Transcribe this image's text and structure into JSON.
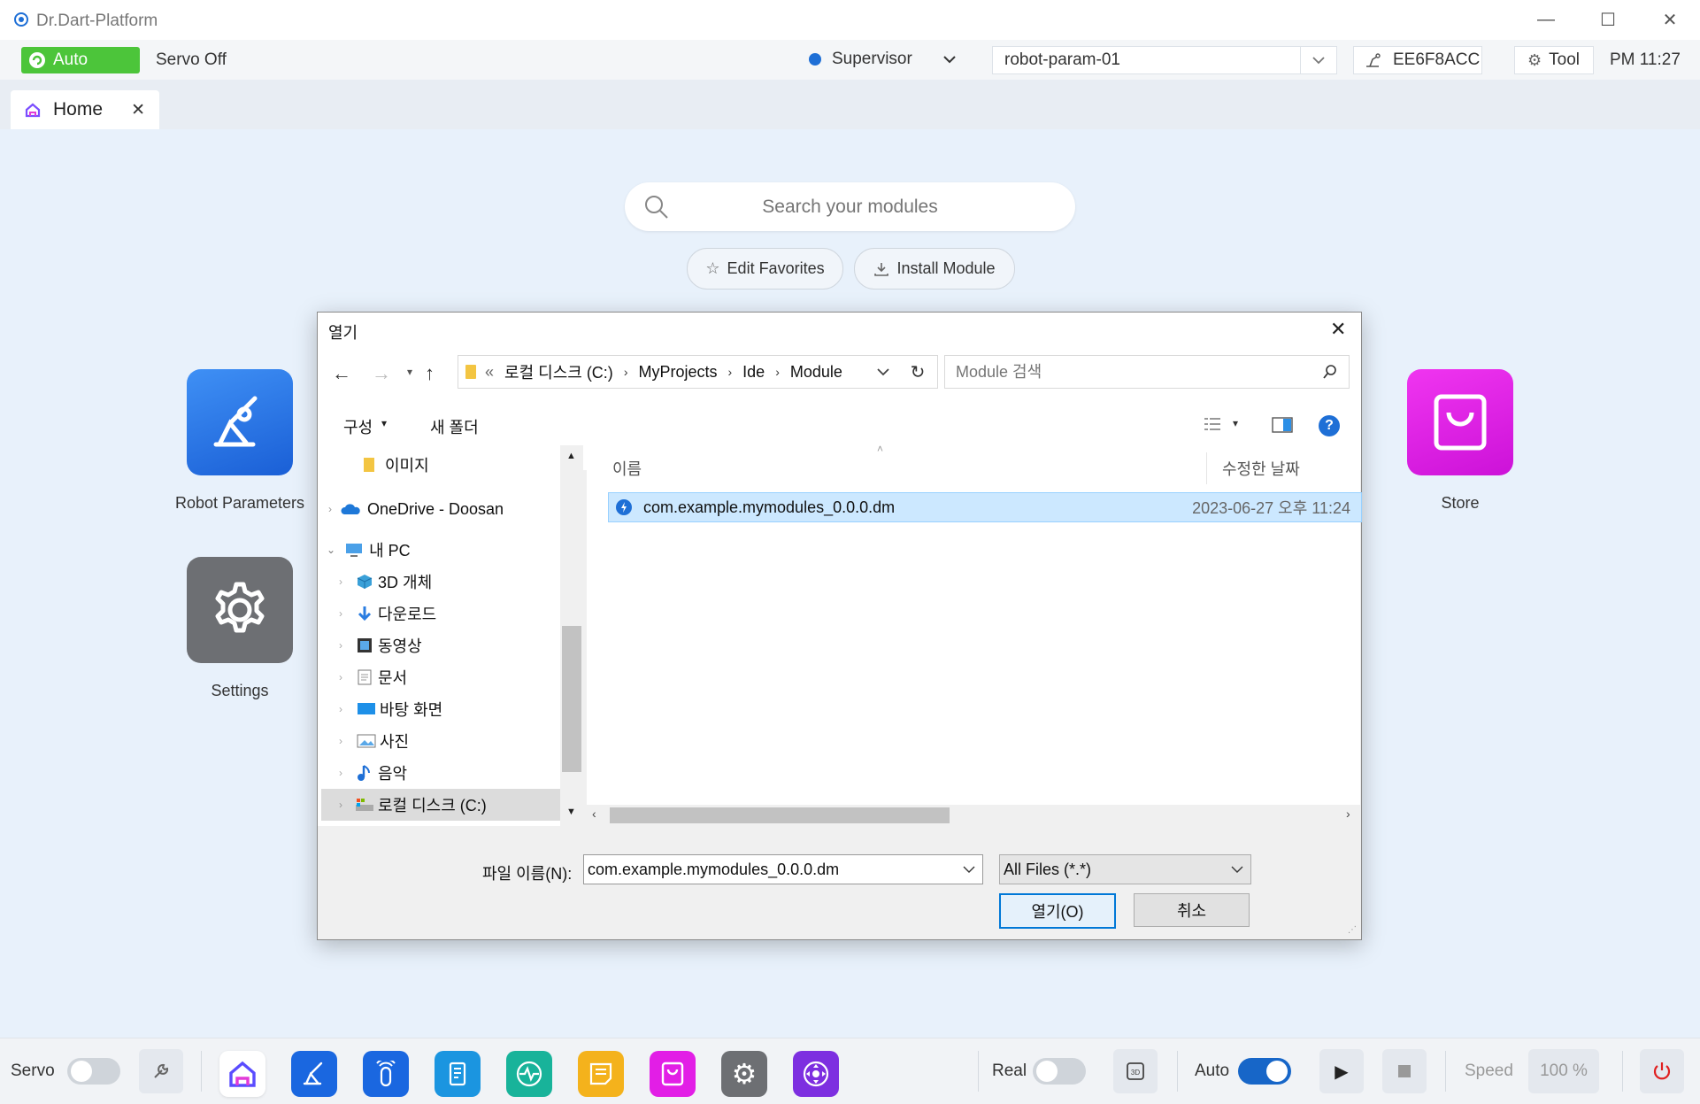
{
  "window": {
    "title": "Dr.Dart-Platform",
    "minimize_icon": "—",
    "maximize_icon": "☐",
    "close_icon": "✕"
  },
  "statusbar": {
    "mode_badge": "Auto",
    "servo_status": "Servo Off",
    "user_role": "Supervisor",
    "robot_param": "robot-param-01",
    "device_id": "EE6F8ACC",
    "tool_label": "Tool",
    "clock": "PM 11:27"
  },
  "tabs": [
    {
      "label": "Home"
    }
  ],
  "home": {
    "search_placeholder": "Search your modules",
    "edit_favorites": "Edit Favorites",
    "install_module": "Install Module",
    "apps": [
      {
        "label": "Robot Parameters"
      },
      {
        "label": "Settings"
      },
      {
        "label": "Store"
      }
    ]
  },
  "dialog": {
    "title": "열기",
    "breadcrumb": [
      "«",
      "로컬 디스크 (C:)",
      "MyProjects",
      "Ide",
      "Module"
    ],
    "search_placeholder": "Module 검색",
    "organize": "구성",
    "new_folder": "새 폴더",
    "nav_items": [
      {
        "label": "이미지",
        "level": 1
      },
      {
        "label": "OneDrive - Doosan",
        "level": 0
      },
      {
        "label": "내 PC",
        "level": 0
      },
      {
        "label": "3D 개체",
        "level": 1
      },
      {
        "label": "다운로드",
        "level": 1
      },
      {
        "label": "동영상",
        "level": 1
      },
      {
        "label": "문서",
        "level": 1
      },
      {
        "label": "바탕 화면",
        "level": 1
      },
      {
        "label": "사진",
        "level": 1
      },
      {
        "label": "음악",
        "level": 1
      },
      {
        "label": "로컬 디스크 (C:)",
        "level": 1
      }
    ],
    "columns": {
      "name": "이름",
      "modified": "수정한 날짜"
    },
    "files": [
      {
        "name": "com.example.mymodules_0.0.0.dm",
        "modified": "2023-06-27 오후 11:24"
      }
    ],
    "filename_label": "파일 이름(N):",
    "filename_value": "com.example.mymodules_0.0.0.dm",
    "filetype": "All Files (*.*)",
    "open_button": "열기(O)",
    "cancel_button": "취소"
  },
  "bottombar": {
    "servo_label": "Servo",
    "real_label": "Real",
    "auto_label": "Auto",
    "speed_label": "Speed",
    "speed_value": "100 %"
  },
  "colors": {
    "accent_blue": "#1e6fd6",
    "auto_green": "#4cc53a",
    "store_magenta": "#e21ee6",
    "settings_gray": "#6d6f73"
  }
}
